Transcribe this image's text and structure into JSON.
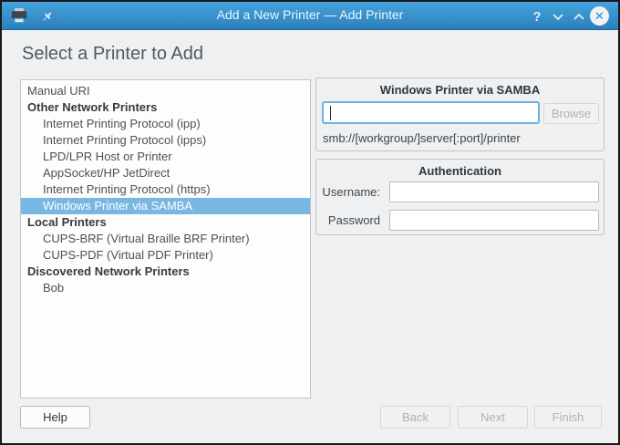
{
  "window": {
    "title": "Add a New Printer — Add Printer",
    "help_glyph": "?",
    "close_glyph": "✕"
  },
  "page": {
    "heading": "Select a Printer to Add"
  },
  "device_list": {
    "selected_item": "Windows Printer via SAMBA",
    "items": [
      {
        "label": "Manual URI",
        "kind": "item",
        "indent": 0,
        "selected": false
      },
      {
        "label": "Other Network Printers",
        "kind": "category",
        "indent": 0,
        "selected": false
      },
      {
        "label": "Internet Printing Protocol (ipp)",
        "kind": "item",
        "indent": 1,
        "selected": false
      },
      {
        "label": "Internet Printing Protocol (ipps)",
        "kind": "item",
        "indent": 1,
        "selected": false
      },
      {
        "label": "LPD/LPR Host or Printer",
        "kind": "item",
        "indent": 1,
        "selected": false
      },
      {
        "label": "AppSocket/HP JetDirect",
        "kind": "item",
        "indent": 1,
        "selected": false
      },
      {
        "label": "Internet Printing Protocol (https)",
        "kind": "item",
        "indent": 1,
        "selected": false
      },
      {
        "label": "Windows Printer via SAMBA",
        "kind": "item",
        "indent": 1,
        "selected": true
      },
      {
        "label": "Local Printers",
        "kind": "category",
        "indent": 0,
        "selected": false
      },
      {
        "label": "CUPS-BRF (Virtual Braille BRF Printer)",
        "kind": "item",
        "indent": 1,
        "selected": false
      },
      {
        "label": "CUPS-PDF (Virtual PDF Printer)",
        "kind": "item",
        "indent": 1,
        "selected": false
      },
      {
        "label": "Discovered Network Printers",
        "kind": "category",
        "indent": 0,
        "selected": false
      },
      {
        "label": "Bob",
        "kind": "item",
        "indent": 1,
        "selected": false
      }
    ]
  },
  "samba_panel": {
    "title": "Windows Printer via SAMBA",
    "address_value": "",
    "browse_label": "Browse",
    "hint": "smb://[workgroup/]server[:port]/printer"
  },
  "auth_panel": {
    "title": "Authentication",
    "username_label": "Username:",
    "username_value": "",
    "password_label": "Password",
    "password_value": ""
  },
  "footer": {
    "help_label": "Help",
    "back_label": "Back",
    "next_label": "Next",
    "finish_label": "Finish"
  },
  "colors": {
    "titlebar_top": "#45a3dd",
    "titlebar_bottom": "#2c80ba",
    "selection": "#79b7e3",
    "focus_border": "#6fb1dd",
    "window_bg": "#eff0f1"
  }
}
